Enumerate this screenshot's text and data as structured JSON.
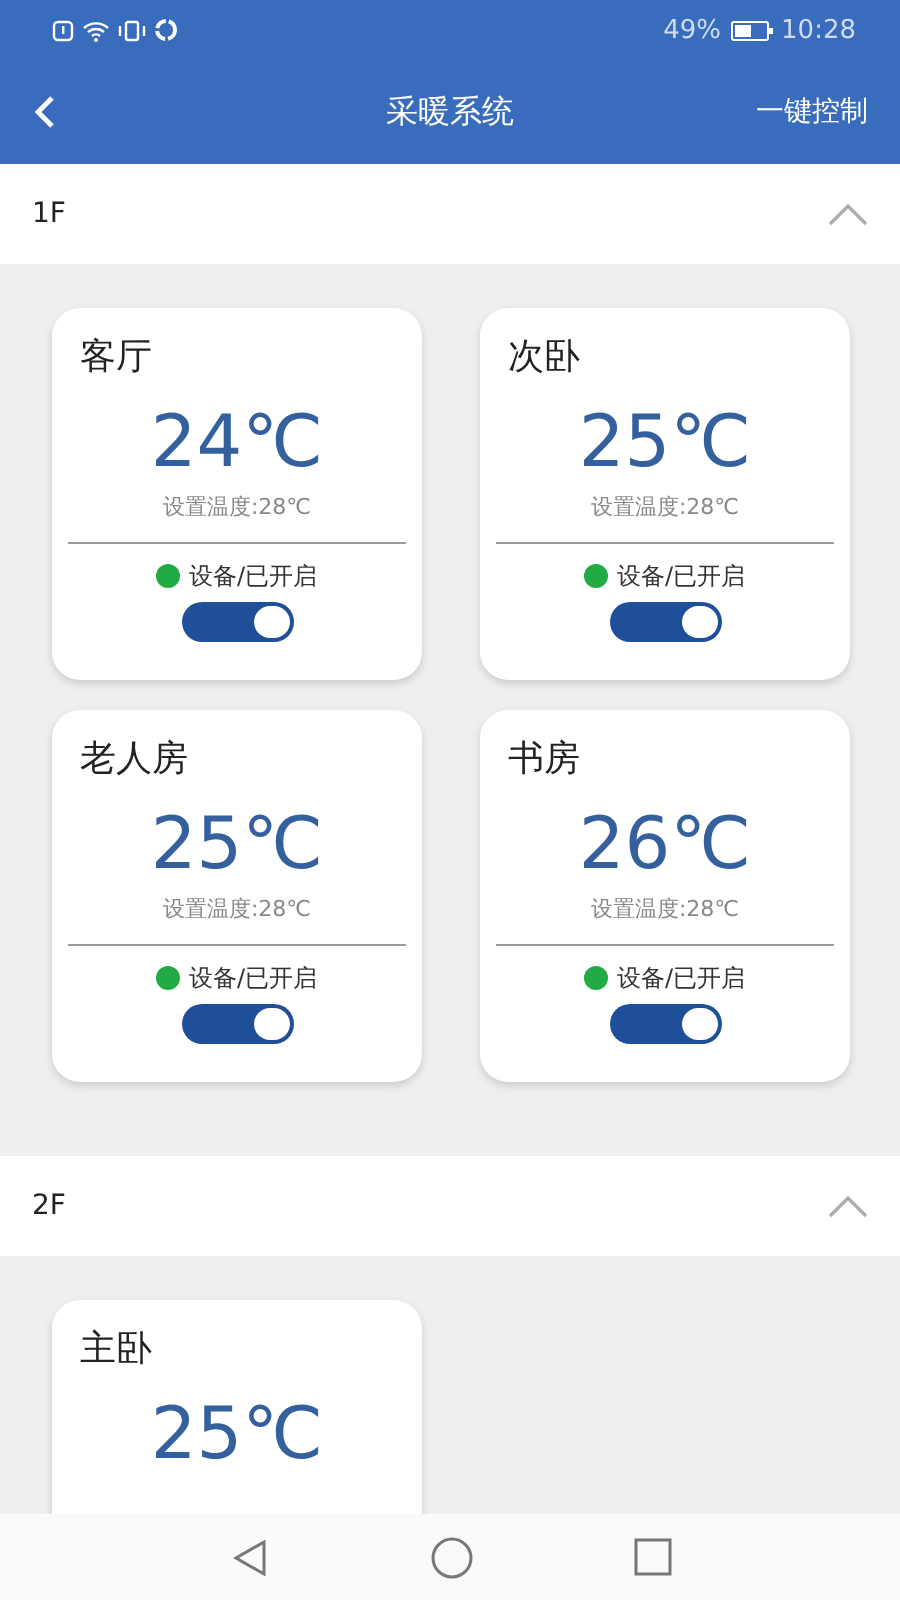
{
  "status_bar": {
    "battery": "49%",
    "time": "10:28"
  },
  "header": {
    "title": "采暖系统",
    "action": "一键控制"
  },
  "floors": [
    {
      "label": "1F",
      "expanded": true,
      "rooms": [
        {
          "name": "客厅",
          "temp": "24℃",
          "setpoint": "设置温度:28℃",
          "status": "设备/已开启",
          "on": true
        },
        {
          "name": "次卧",
          "temp": "25℃",
          "setpoint": "设置温度:28℃",
          "status": "设备/已开启",
          "on": true
        },
        {
          "name": "老人房",
          "temp": "25℃",
          "setpoint": "设置温度:28℃",
          "status": "设备/已开启",
          "on": true
        },
        {
          "name": "书房",
          "temp": "26℃",
          "setpoint": "设置温度:28℃",
          "status": "设备/已开启",
          "on": true
        }
      ]
    },
    {
      "label": "2F",
      "expanded": true,
      "rooms": [
        {
          "name": "主卧",
          "temp": "25℃"
        }
      ]
    }
  ]
}
